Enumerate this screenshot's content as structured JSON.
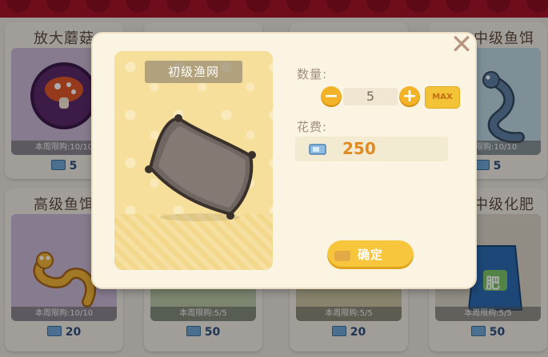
{
  "shop": {
    "cards": [
      {
        "name": "放大蘑菇",
        "limit": "本周限购:10/10",
        "price": "5"
      },
      {
        "name": "",
        "limit": "",
        "price": ""
      },
      {
        "name": "",
        "limit": "",
        "price": ""
      },
      {
        "name": "中级鱼饵",
        "limit": "本周限购:10/10",
        "price": "5"
      },
      {
        "name": "高级鱼饵",
        "limit": "本周限购:10/10",
        "price": "20"
      },
      {
        "name": "",
        "limit": "本周限购:5/5",
        "price": "50"
      },
      {
        "name": "",
        "limit": "本周限购:5/5",
        "price": "20"
      },
      {
        "name": "中级化肥",
        "limit": "本周限购:5/5",
        "price": "50"
      }
    ],
    "fertilizer_bag_text": "肥"
  },
  "dialog": {
    "item_name": "初级渔网",
    "quantity_label": "数量:",
    "quantity": "5",
    "max_label": "MAX",
    "cost_label": "花费:",
    "cost": "250",
    "confirm_label": "确定",
    "close_icon": "close-icon"
  },
  "colors": {
    "accent_yellow": "#f2b327",
    "cost_orange": "#e08a23",
    "panel_bg": "#fbf4e2",
    "preview_bg": "#f6df9b"
  }
}
